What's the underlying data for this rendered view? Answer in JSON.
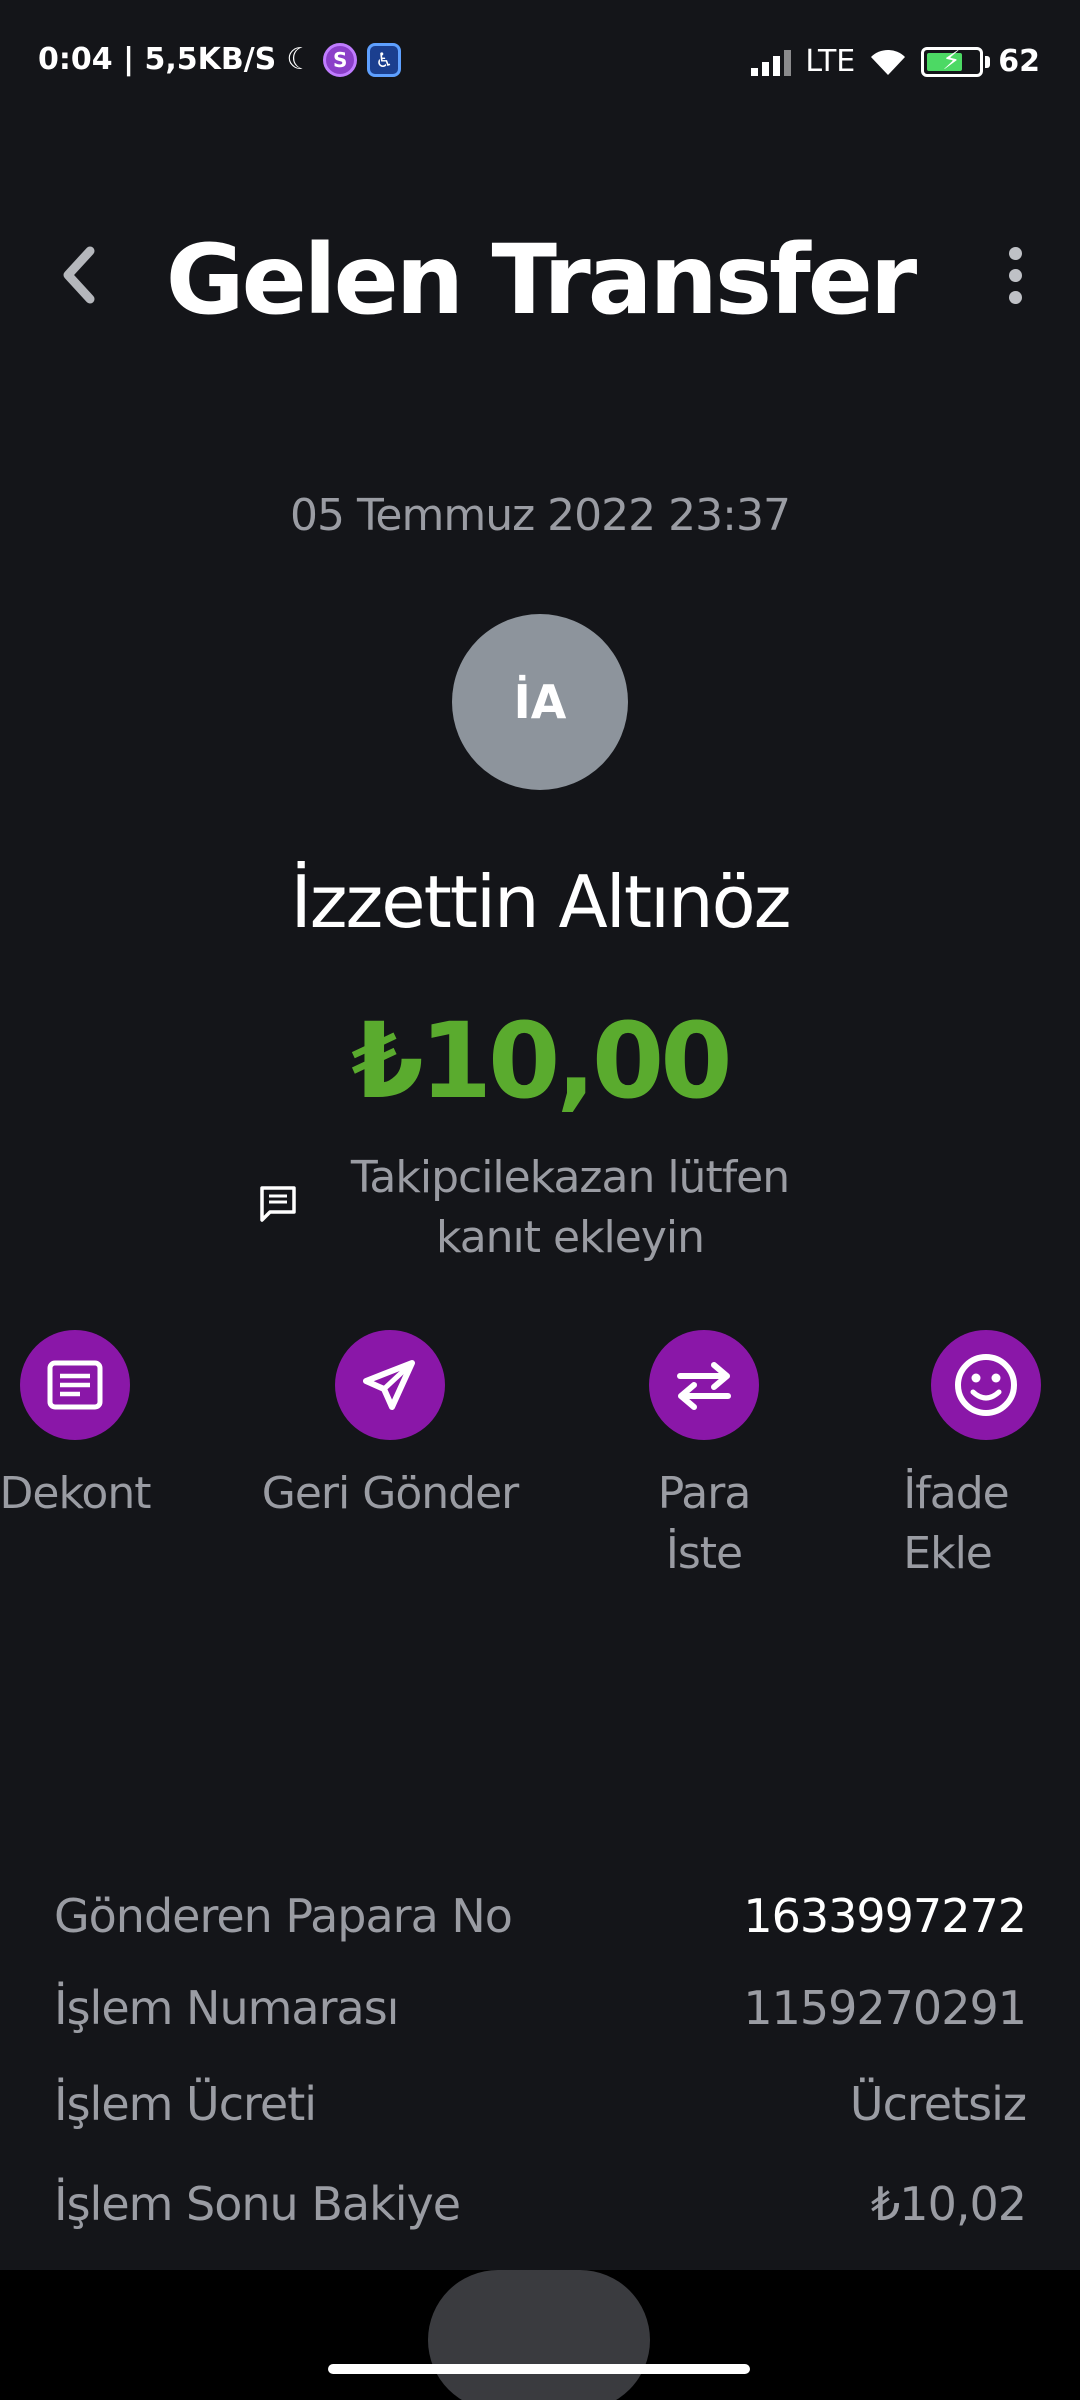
{
  "status_bar": {
    "time_speed": "0:04 | 5,5KB/S",
    "network": "LTE",
    "battery": "62"
  },
  "header": {
    "title": "Gelen Transfer"
  },
  "transfer": {
    "date": "05 Temmuz 2022 23:37",
    "avatar_initials": "İA",
    "sender_name": "İzzettin Altınöz",
    "amount": "₺10,00",
    "note": "Takipcilekazan lütfen kanıt ekleyin"
  },
  "actions": [
    {
      "label": "Dekont",
      "icon": "receipt-icon"
    },
    {
      "label": "Geri Gönder",
      "icon": "send-icon"
    },
    {
      "label": "Para\nİste",
      "icon": "swap-arrows-icon"
    },
    {
      "label": "İfade\nEkle",
      "icon": "smiley-icon"
    }
  ],
  "details": [
    {
      "key": "Gönderen Papara No",
      "value": "1633997272"
    },
    {
      "key": "İşlem Numarası",
      "value": "1159270291"
    },
    {
      "key": "İşlem Ücreti",
      "value": "Ücretsiz"
    },
    {
      "key": "İşlem Sonu Bakiye",
      "value": "₺10,02"
    }
  ],
  "colors": {
    "background": "#141519",
    "amount_green": "#5aab2e",
    "action_purple": "#8a17a8",
    "muted_text": "#9a9ca3"
  }
}
